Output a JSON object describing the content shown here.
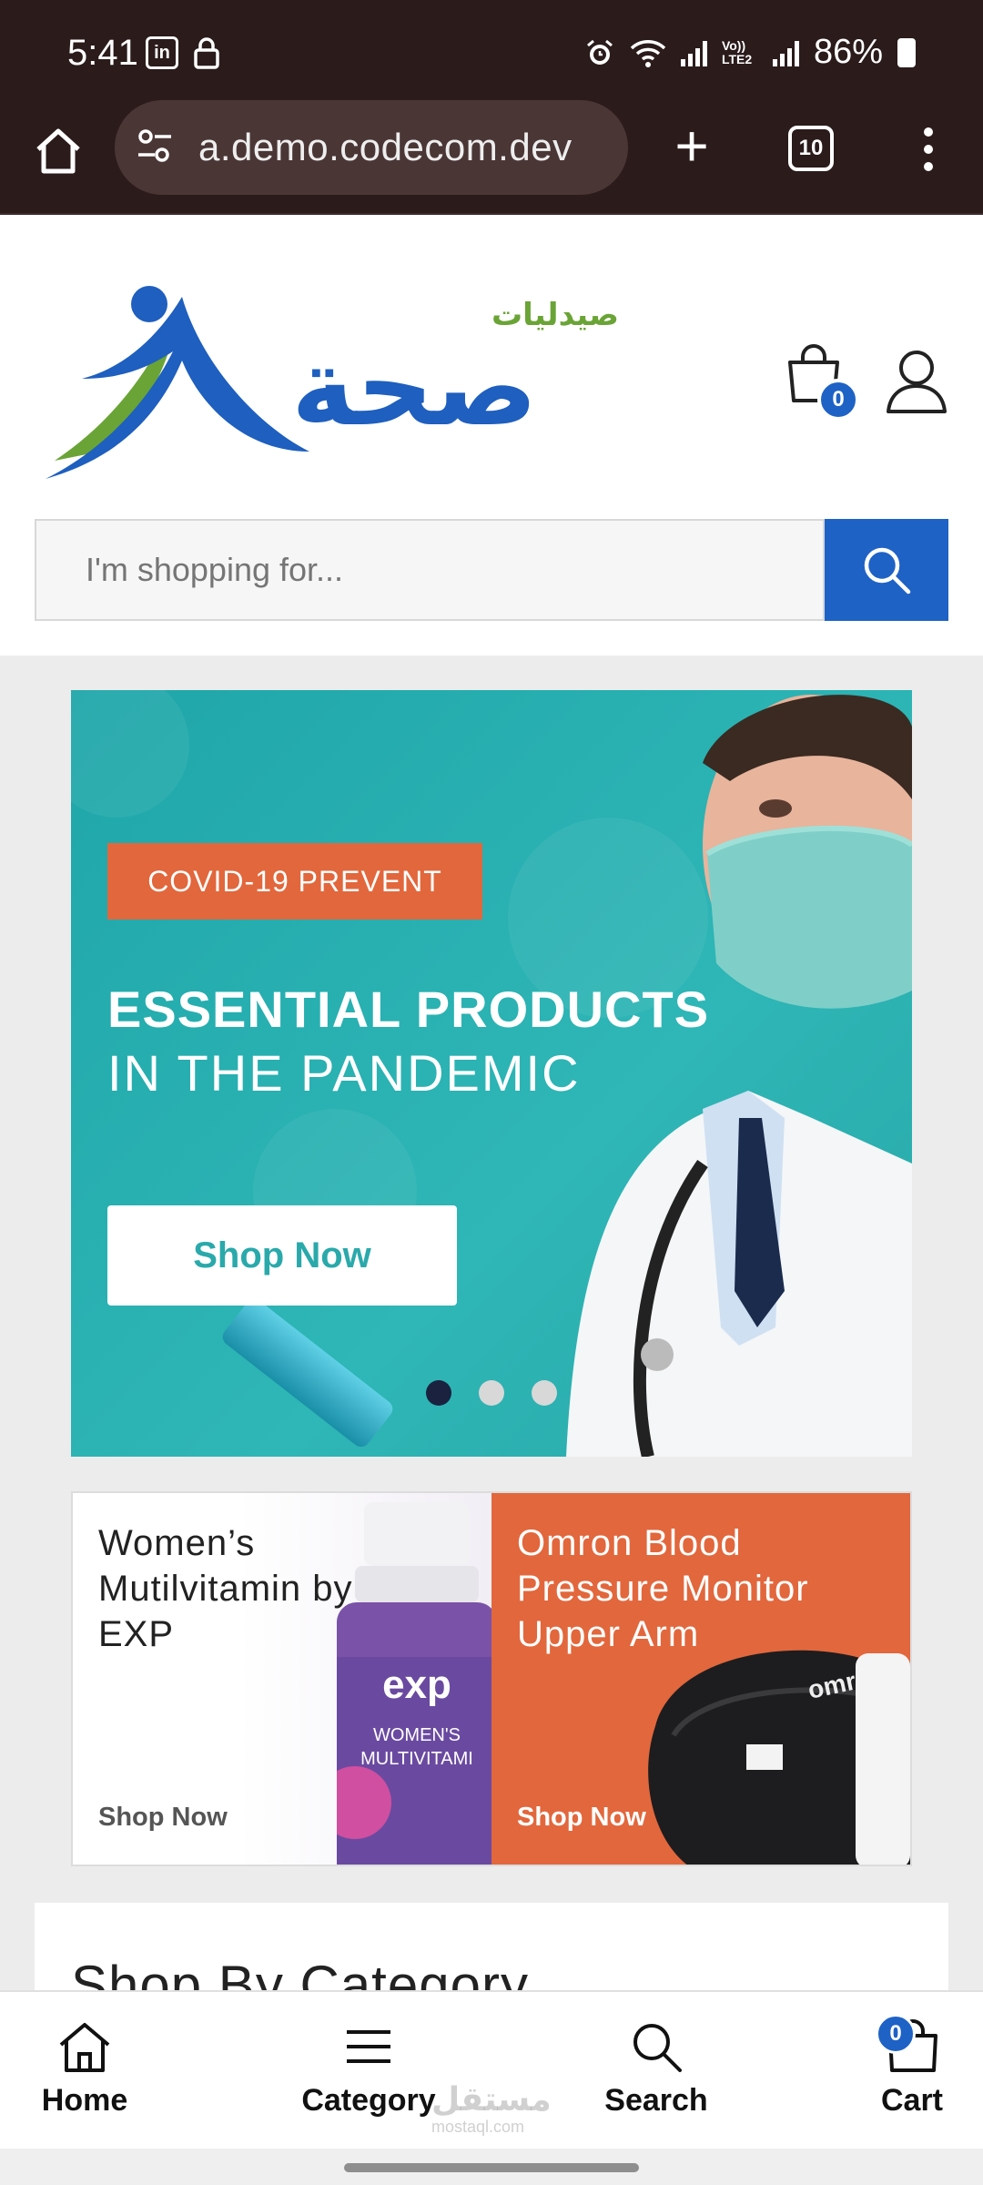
{
  "status_bar": {
    "time": "5:41",
    "linkedin_icon_text": "in",
    "battery": "86%",
    "net_label": "Vo)) LTE2"
  },
  "browser": {
    "url": "a.demo.codecom.dev",
    "tab_count": "10"
  },
  "header": {
    "logo_small": "صيدليات",
    "logo_big": "صحة",
    "cart_count": "0",
    "search_placeholder": "I'm shopping for..."
  },
  "hero": {
    "tag": "COVID-19 PREVENT",
    "title_line1": "ESSENTIAL PRODUCTS",
    "title_line2": "IN THE PANDEMIC",
    "cta": "Shop Now",
    "slide_count": 3,
    "active_slide": 1
  },
  "promos": [
    {
      "title": "Women’s Mutilvitamin by EXP",
      "cta": "Shop Now",
      "bottle_brand": "exp",
      "bottle_line1": "WOMEN'S",
      "bottle_line2": "MULTIVITAMI"
    },
    {
      "title": "Omron Blood Pressure Monitor Upper Arm",
      "cta": "Shop Now",
      "device_brand": "omron"
    }
  ],
  "category_section": {
    "title": "Shop By Category"
  },
  "bottom_nav": {
    "items": [
      {
        "label": "Home"
      },
      {
        "label": "Category"
      },
      {
        "label": "Search"
      },
      {
        "label": "Cart"
      }
    ],
    "cart_badge": "0"
  },
  "watermark": {
    "arabic": "مستقل",
    "latin": "mostaql.com"
  },
  "colors": {
    "brand_blue": "#1e62c6",
    "brand_green": "#6aa436",
    "hero_teal": "#2fb6b6",
    "accent_orange": "#e2673c",
    "browser_bg": "#2b1b1b"
  }
}
